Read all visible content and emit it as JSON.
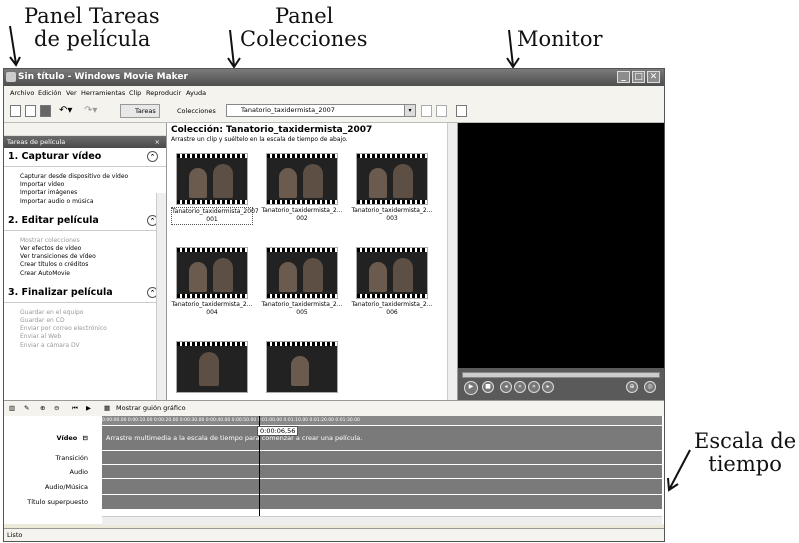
{
  "callouts": {
    "tasks_panel": [
      "Panel Tareas",
      "de película"
    ],
    "collections_panel": [
      "Panel",
      "Colecciones"
    ],
    "monitor": "Monitor",
    "timeline": [
      "Escala de",
      "tiempo"
    ]
  },
  "window": {
    "title": "Sin título - Windows Movie Maker",
    "menu": [
      "Archivo",
      "Edición",
      "Ver",
      "Herramientas",
      "Clip",
      "Reproducir",
      "Ayuda"
    ]
  },
  "toolbar": {
    "tasks_label": "Tareas",
    "collections_label": "Colecciones",
    "collection_selected": "Tanatorio_taxidermista_2007"
  },
  "tasks_pane": {
    "header": "Tareas de película",
    "close": "×",
    "sections": [
      {
        "title": "1. Capturar vídeo",
        "items": [
          "Capturar desde dispositivo de vídeo",
          "Importar vídeo",
          "Importar imágenes",
          "Importar audio o música"
        ]
      },
      {
        "title": "2. Editar película",
        "items": [
          "Mostrar colecciones",
          "Ver efectos de vídeo",
          "Ver transiciones de vídeo",
          "Crear títulos o créditos",
          "Crear AutoMovie"
        ]
      },
      {
        "title": "3. Finalizar película",
        "items": [
          "Guardar en el equipo",
          "Guardar en CD",
          "Enviar por correo electrónico",
          "Enviar al Web",
          "Enviar a cámara DV"
        ]
      }
    ]
  },
  "collection": {
    "title": "Colección: Tanatorio_taxidermista_2007",
    "subtitle": "Arrastre un clip y suéltelo en la escala de tiempo de abajo.",
    "clips": [
      "Tanatorio_taxidermista_2007 001",
      "Tanatorio_taxidermista_2... 002",
      "Tanatorio_taxidermista_2... 003",
      "Tanatorio_taxidermista_2... 004",
      "Tanatorio_taxidermista_2... 005",
      "Tanatorio_taxidermista_2... 006"
    ]
  },
  "timeline": {
    "show_storyboard": "Mostrar guión gráfico",
    "time": "0:00:06,56",
    "video_hint": "Arrastre multimedia a la escala de tiempo para comenzar a crear una película.",
    "ruler": "0:00:00.00      0:00:10.00      0:00:20.00      0:00:30.00      0:00:40.00      0:00:50.00      0:01:00.00      0:01:10.00      0:01:20.00      0:01:30.00",
    "tracks": [
      "Vídeo",
      "Transición",
      "Audio",
      "Audio/Música",
      "Título superpuesto"
    ]
  },
  "status": "Listo"
}
